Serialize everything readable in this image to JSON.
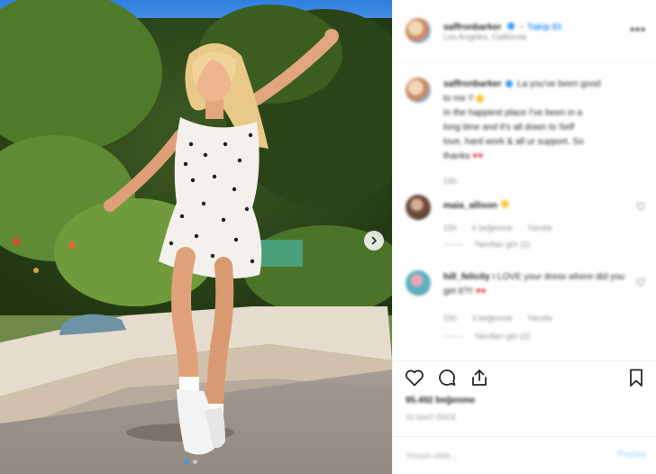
{
  "photo": {
    "alt_subject": "",
    "carousel_count": 2,
    "carousel_active": 0
  },
  "header": {
    "username": "saffronbarker",
    "follow_label": "Takip Et",
    "separator": "•",
    "location": "Los Angeles, California"
  },
  "caption": {
    "username": "saffronbarker",
    "lines": [
      "La you've been good",
      "to me !! ",
      "In the happiest place I've been in a",
      "long time and it's all down to Self",
      "love, hard work & all ur support. So",
      "thanks "
    ],
    "timestamp": "15h"
  },
  "comments": [
    {
      "username": "maia_allison",
      "text": "",
      "time": "15h",
      "likes_label": "4 beğenme",
      "reply_label": "Yanıtla",
      "view_replies": "Yanıtları gör (1)"
    },
    {
      "username": "hill_felicity",
      "text": "I LOVE your dress where did you get it?!!",
      "time": "15h",
      "likes_label": "3 beğenme",
      "reply_label": "Yanıtla",
      "view_replies": "Yanıtları gör (2)"
    }
  ],
  "actions": {
    "likes_count": "95.492 beğenme",
    "time_ago": "15 SAAT ÖNCE",
    "icons": [
      "heart-icon",
      "comment-icon",
      "share-icon",
      "bookmark-icon"
    ]
  },
  "comment_box": {
    "placeholder": "Yorum ekle...",
    "post_label": "Paylaş"
  },
  "colors": {
    "accent": "#3897f0",
    "muted": "#8e8e8e",
    "border": "#efefef"
  }
}
